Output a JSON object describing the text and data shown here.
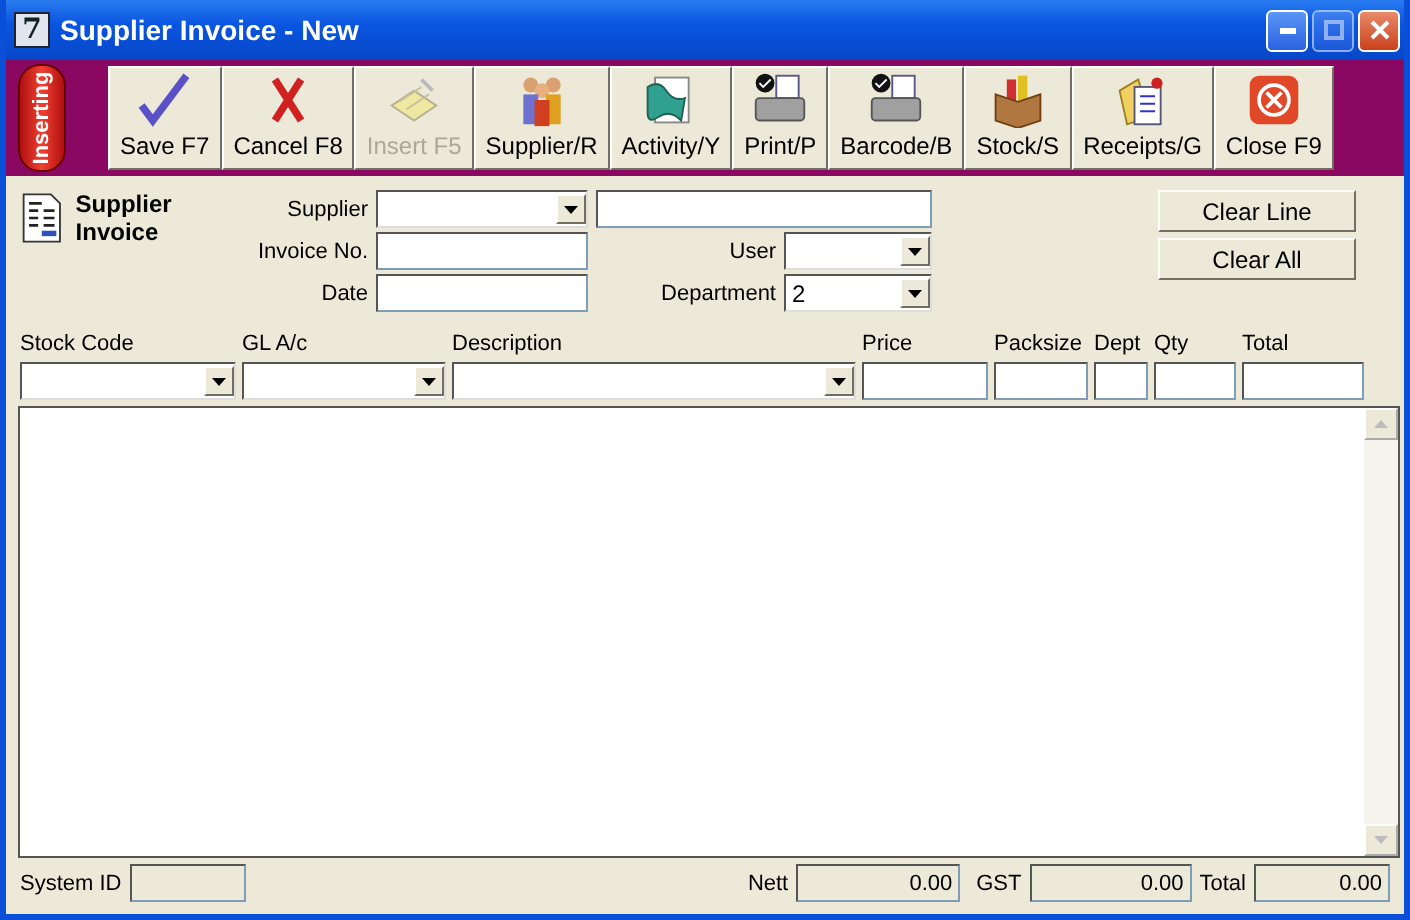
{
  "window": {
    "title": "Supplier Invoice - New",
    "app_icon": "7"
  },
  "mode_badge": "Inserting",
  "toolbar": [
    {
      "label": "Save F7",
      "disabled": false
    },
    {
      "label": "Cancel F8",
      "disabled": false
    },
    {
      "label": "Insert F5",
      "disabled": true
    },
    {
      "label": "Supplier/R",
      "disabled": false
    },
    {
      "label": "Activity/Y",
      "disabled": false
    },
    {
      "label": "Print/P",
      "disabled": false
    },
    {
      "label": "Barcode/B",
      "disabled": false
    },
    {
      "label": "Stock/S",
      "disabled": false
    },
    {
      "label": "Receipts/G",
      "disabled": false
    },
    {
      "label": "Close F9",
      "disabled": false
    }
  ],
  "form_title": "Supplier Invoice",
  "header": {
    "supplier_label": "Supplier",
    "invoice_label": "Invoice No.",
    "date_label": "Date",
    "user_label": "User",
    "department_label": "Department",
    "department_value": "2"
  },
  "buttons": [
    "Clear Line",
    "Clear All"
  ],
  "columns": [
    "Stock Code",
    "GL A/c",
    "Description",
    "Price",
    "Packsize",
    "Dept",
    "Qty",
    "Total"
  ],
  "status_bar": {
    "system_id_label": "System ID",
    "nett_label": "Nett",
    "nett": "0.00",
    "gst_label": "GST",
    "gst": "0.00",
    "total_label": "Total",
    "total": "0.00"
  }
}
